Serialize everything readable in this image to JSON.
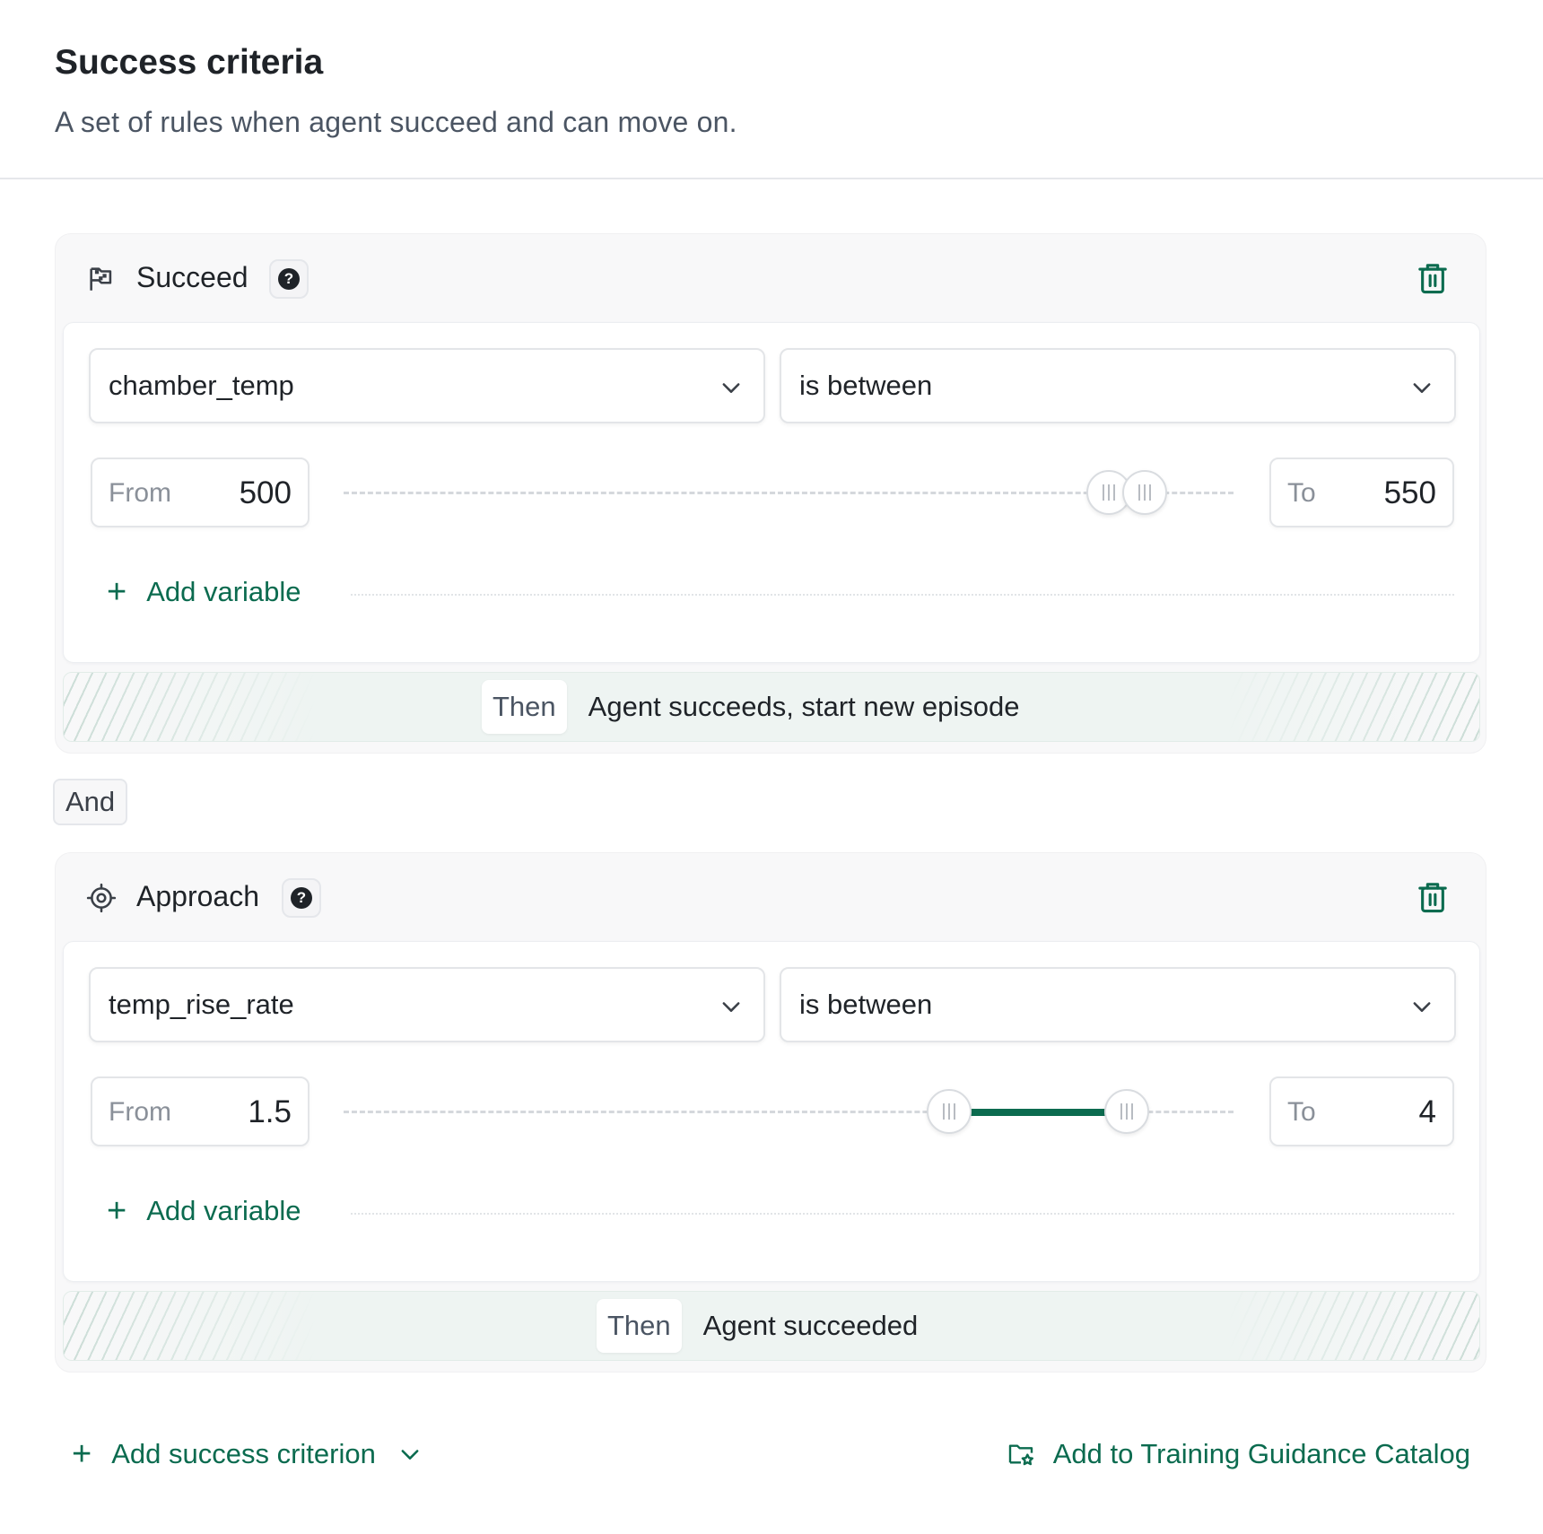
{
  "header": {
    "title": "Success criteria",
    "subtitle": "A set of rules when agent succeed and can move on."
  },
  "criteria": [
    {
      "title": "Succeed",
      "icon": "flag-icon",
      "variable": "chamber_temp",
      "operator": "is between",
      "from_label": "From",
      "from_value": "500",
      "to_label": "To",
      "to_value": "550",
      "range_fraction": [
        0.86,
        0.9
      ],
      "add_variable_label": "Add variable",
      "then_label": "Then",
      "then_text": "Agent succeeds, start new episode"
    },
    {
      "title": "Approach",
      "icon": "target-icon",
      "variable": "temp_rise_rate",
      "operator": "is between",
      "from_label": "From",
      "from_value": "1.5",
      "to_label": "To",
      "to_value": "4",
      "range_fraction": [
        0.68,
        0.88
      ],
      "add_variable_label": "Add variable",
      "then_label": "Then",
      "then_text": "Agent succeeded"
    }
  ],
  "connector_label": "And",
  "footer": {
    "add_criterion_label": "Add success criterion",
    "catalog_label": "Add to Training Guidance Catalog"
  },
  "colors": {
    "accent": "#0b6b4f",
    "text": "#1f2328",
    "muted": "#8a9099"
  }
}
